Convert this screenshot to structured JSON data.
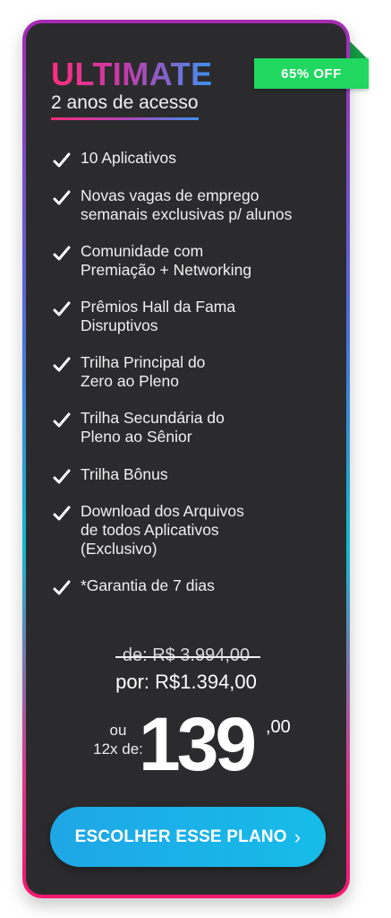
{
  "plan": {
    "name": "ULTIMATE",
    "duration": "2 anos de acesso",
    "badge": "65% OFF"
  },
  "features": [
    [
      "10 Aplicativos"
    ],
    [
      "Novas vagas de emprego",
      "semanais exclusivas p/ alunos"
    ],
    [
      "Comunidade com",
      "Premiação + Networking"
    ],
    [
      "Prêmios Hall da Fama",
      "Disruptivos"
    ],
    [
      "Trilha Principal do",
      "Zero ao Pleno"
    ],
    [
      "Trilha Secundária do",
      "Pleno ao Sênior"
    ],
    [
      "Trilha Bônus"
    ],
    [
      "Download dos Arquivos",
      "de todos Aplicativos",
      "(Exclusivo)"
    ],
    [
      "*Garantia de 7 dias"
    ]
  ],
  "pricing": {
    "old_price": "de: R$ 3.994,00",
    "current_price": "por: R$1.394,00",
    "installment_or": "ou",
    "installment_count": "12x de:",
    "installment_value": "139",
    "installment_cents": ",00"
  },
  "cta": {
    "label": "ESCOLHER ESSE PLANO",
    "chevron": "›"
  },
  "icons": {
    "check": "check-icon",
    "cta_arrow": "chevron-right-icon"
  },
  "colors": {
    "card_background": "#2b2b2d",
    "badge_green": "#20d760",
    "cta_blue": "#1fa6e6",
    "title_gradient_start": "#ff2d7a",
    "title_gradient_end": "#3b92f0"
  }
}
